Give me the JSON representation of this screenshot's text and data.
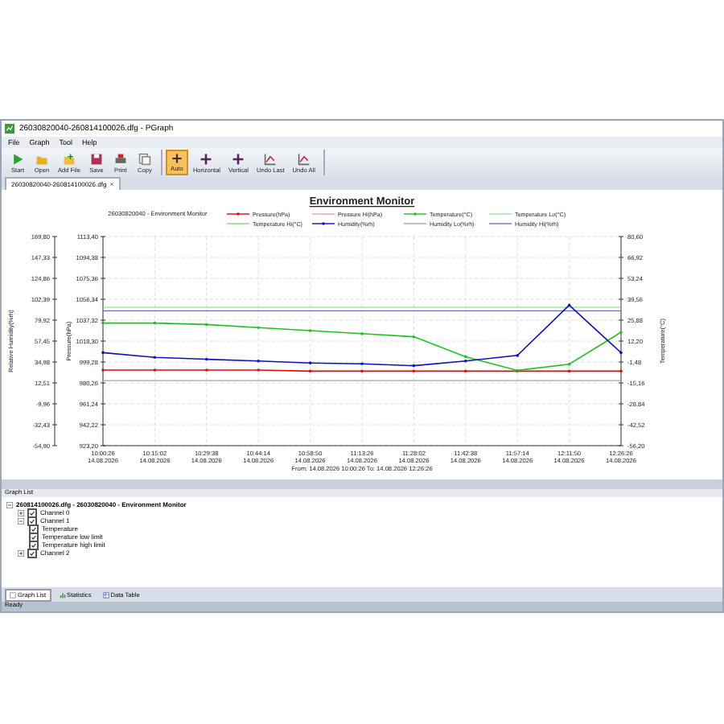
{
  "window": {
    "title": "26030820040-260814100026.dfg - PGraph"
  },
  "menu": [
    "File",
    "Graph",
    "Tool",
    "Help"
  ],
  "toolbar": [
    {
      "buttons": [
        {
          "label": "Start",
          "selected": false
        },
        {
          "label": "Open",
          "selected": false
        },
        {
          "label": "Add File",
          "selected": false
        },
        {
          "label": "Save",
          "selected": false
        },
        {
          "label": "Print",
          "selected": false
        },
        {
          "label": "Copy",
          "selected": false
        }
      ]
    },
    {
      "buttons": [
        {
          "label": "Auto",
          "selected": true
        },
        {
          "label": "Horizontal",
          "selected": false
        },
        {
          "label": "Vertical",
          "selected": false
        },
        {
          "label": "Undo Last",
          "selected": false
        },
        {
          "label": "Undo All",
          "selected": false
        }
      ]
    }
  ],
  "document_tabs": [
    {
      "label": "26030820040-260814100026.dfg",
      "selected": true,
      "close": "×"
    }
  ],
  "chart": {
    "title": "Environment Monitor",
    "device": "26030820040 - Environment Monitor",
    "x_dates": [
      "14.08.2026",
      "14.08.2026",
      "14.08.2026",
      "14.08.2026",
      "14.08.2026",
      "14.08.2026",
      "14.08.2026",
      "14.08.2026",
      "14.08.2026",
      "14.08.2026",
      "14.08.2026"
    ],
    "range": "From: 14.08.2026 10:00:26   To: 14.08.2026 12:26:26",
    "chart_data": {
      "type": "line",
      "grid": true,
      "legend": true,
      "ylim": [
        -54.9,
        169.8
      ],
      "y2lim": [
        923.2,
        1113.4
      ],
      "y3lim": [
        -56.2,
        80.6
      ],
      "ylabel": "Relative Humidity(%rh)",
      "y2label": "Pressure(hPa)",
      "y3label": "Temperature(°C)",
      "yticks": [
        {
          "value": 169.8,
          "label": "169,80"
        },
        {
          "value": 147.33,
          "label": "147,33"
        },
        {
          "value": 124.86,
          "label": "124,86"
        },
        {
          "value": 102.39,
          "label": "102,39"
        },
        {
          "value": 79.92,
          "label": "79,92"
        },
        {
          "value": 57.45,
          "label": "57,45"
        },
        {
          "value": 34.98,
          "label": "34,98"
        },
        {
          "value": 12.51,
          "label": "12,51"
        },
        {
          "value": -9.96,
          "label": "-9,96"
        },
        {
          "value": -32.43,
          "label": "-32,43"
        },
        {
          "value": -54.9,
          "label": "-54,90"
        }
      ],
      "y2ticks": [
        {
          "value": 1113.4,
          "label": "1113,40"
        },
        {
          "value": 1094.38,
          "label": "1094,38"
        },
        {
          "value": 1075.36,
          "label": "1075,36"
        },
        {
          "value": 1056.34,
          "label": "1056,34"
        },
        {
          "value": 1037.32,
          "label": "1037,32"
        },
        {
          "value": 1018.3,
          "label": "1018,30"
        },
        {
          "value": 999.28,
          "label": "999,28"
        },
        {
          "value": 980.26,
          "label": "980,26"
        },
        {
          "value": 961.24,
          "label": "961,24"
        },
        {
          "value": 942.22,
          "label": "942,22"
        },
        {
          "value": 923.2,
          "label": "923,20"
        }
      ],
      "y3ticks": [
        {
          "value": 80.6,
          "label": "80,60"
        },
        {
          "value": 66.92,
          "label": "66,92"
        },
        {
          "value": 53.24,
          "label": "53,24"
        },
        {
          "value": 39.56,
          "label": "39,56"
        },
        {
          "value": 25.88,
          "label": "25,88"
        },
        {
          "value": 12.2,
          "label": "12,20"
        },
        {
          "value": -1.48,
          "label": "-1,48"
        },
        {
          "value": -15.16,
          "label": "-15,16"
        },
        {
          "value": -28.84,
          "label": "-28,84"
        },
        {
          "value": -42.52,
          "label": "-42,52"
        },
        {
          "value": -56.2,
          "label": "-56,20"
        }
      ],
      "categories": [
        "10:00:26",
        "10:15:02",
        "10:29:38",
        "10:44:14",
        "10:58:50",
        "11:13:26",
        "11:28:02",
        "11:42:38",
        "11:57:14",
        "12:11:50",
        "12:26:26"
      ],
      "series": [
        {
          "name": "Pressure(hPa)",
          "color": "#d01010",
          "axis": "y2",
          "values": [
            992,
            992,
            992,
            992,
            991,
            991,
            991,
            991,
            991,
            991,
            991
          ]
        },
        {
          "name": "Temperature(°C)",
          "color": "#20c020",
          "axis": "y3",
          "values": [
            24,
            24,
            23,
            21,
            19,
            17,
            15,
            2,
            -7,
            -3,
            18
          ]
        },
        {
          "name": "Humidity(%rh)",
          "color": "#1010c0",
          "values": [
            45,
            40,
            38,
            36,
            34,
            33,
            31,
            36,
            42,
            96,
            45
          ]
        }
      ],
      "ref_lines": [
        {
          "label": "Pressure Hi(hPa)",
          "color": "#f0a0b0",
          "axis": "y2"
        },
        {
          "label": "Temperature Lo(°C)",
          "color": "#a0e0a0",
          "axis": "y3"
        },
        {
          "label": "Temperature Hi(°C)",
          "color": "#80d880",
          "axis": "y3",
          "value": 34.3
        },
        {
          "label": "Humidity Lo(%rh)",
          "color": "#90a8c0",
          "axis": "y",
          "value": 15
        },
        {
          "label": "Humidity Hi(%rh)",
          "color": "#7070c8",
          "axis": "y",
          "value": 90
        }
      ]
    }
  },
  "graph_list": {
    "title": "Graph List",
    "tree": [
      {
        "label": "260814100026.dfg - 26030820040 - Environment Monitor",
        "expanded": true,
        "children": [
          {
            "label": "Channel 0",
            "expanded": false,
            "checked": true
          },
          {
            "label": "Channel 1",
            "expanded": true,
            "checked": true,
            "children": [
              {
                "label": "Temperature",
                "checked": true
              },
              {
                "label": "Temperature low limit",
                "checked": true
              },
              {
                "label": "Temperature high limit",
                "checked": true
              }
            ]
          },
          {
            "label": "Channel 2",
            "expanded": false,
            "checked": true
          }
        ]
      }
    ]
  },
  "bottom_tabs": [
    {
      "label": "Graph List",
      "selected": true
    },
    {
      "label": "Statistics",
      "selected": false
    },
    {
      "label": "Data Table",
      "selected": false
    }
  ],
  "status_bar": "Ready"
}
